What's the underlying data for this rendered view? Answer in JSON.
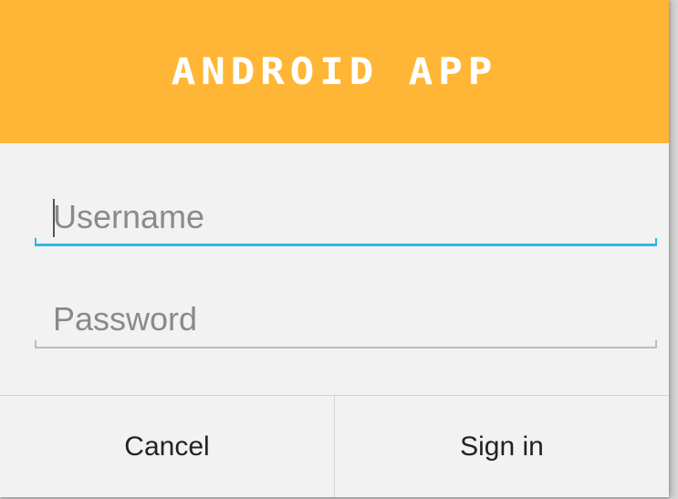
{
  "dialog": {
    "title": "ANDROID APP",
    "header_color": "#ffb535"
  },
  "form": {
    "username": {
      "placeholder": "Username",
      "value": "",
      "focused": true,
      "accent_color": "#33b5e5"
    },
    "password": {
      "placeholder": "Password",
      "value": ""
    }
  },
  "buttons": {
    "cancel_label": "Cancel",
    "sign_in_label": "Sign in"
  }
}
